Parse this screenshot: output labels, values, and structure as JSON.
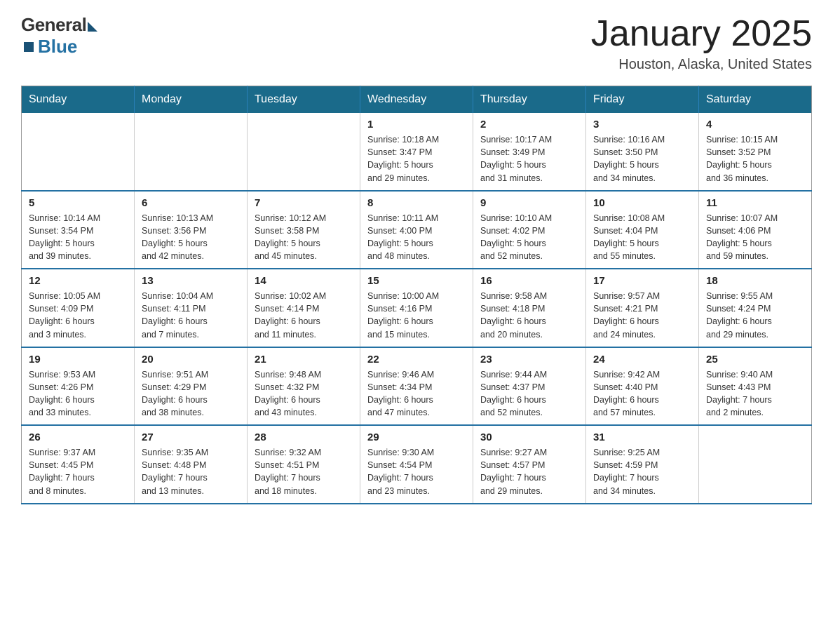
{
  "logo": {
    "general": "General",
    "blue": "Blue"
  },
  "header": {
    "month": "January 2025",
    "location": "Houston, Alaska, United States"
  },
  "weekdays": [
    "Sunday",
    "Monday",
    "Tuesday",
    "Wednesday",
    "Thursday",
    "Friday",
    "Saturday"
  ],
  "weeks": [
    [
      {
        "day": "",
        "info": ""
      },
      {
        "day": "",
        "info": ""
      },
      {
        "day": "",
        "info": ""
      },
      {
        "day": "1",
        "info": "Sunrise: 10:18 AM\nSunset: 3:47 PM\nDaylight: 5 hours\nand 29 minutes."
      },
      {
        "day": "2",
        "info": "Sunrise: 10:17 AM\nSunset: 3:49 PM\nDaylight: 5 hours\nand 31 minutes."
      },
      {
        "day": "3",
        "info": "Sunrise: 10:16 AM\nSunset: 3:50 PM\nDaylight: 5 hours\nand 34 minutes."
      },
      {
        "day": "4",
        "info": "Sunrise: 10:15 AM\nSunset: 3:52 PM\nDaylight: 5 hours\nand 36 minutes."
      }
    ],
    [
      {
        "day": "5",
        "info": "Sunrise: 10:14 AM\nSunset: 3:54 PM\nDaylight: 5 hours\nand 39 minutes."
      },
      {
        "day": "6",
        "info": "Sunrise: 10:13 AM\nSunset: 3:56 PM\nDaylight: 5 hours\nand 42 minutes."
      },
      {
        "day": "7",
        "info": "Sunrise: 10:12 AM\nSunset: 3:58 PM\nDaylight: 5 hours\nand 45 minutes."
      },
      {
        "day": "8",
        "info": "Sunrise: 10:11 AM\nSunset: 4:00 PM\nDaylight: 5 hours\nand 48 minutes."
      },
      {
        "day": "9",
        "info": "Sunrise: 10:10 AM\nSunset: 4:02 PM\nDaylight: 5 hours\nand 52 minutes."
      },
      {
        "day": "10",
        "info": "Sunrise: 10:08 AM\nSunset: 4:04 PM\nDaylight: 5 hours\nand 55 minutes."
      },
      {
        "day": "11",
        "info": "Sunrise: 10:07 AM\nSunset: 4:06 PM\nDaylight: 5 hours\nand 59 minutes."
      }
    ],
    [
      {
        "day": "12",
        "info": "Sunrise: 10:05 AM\nSunset: 4:09 PM\nDaylight: 6 hours\nand 3 minutes."
      },
      {
        "day": "13",
        "info": "Sunrise: 10:04 AM\nSunset: 4:11 PM\nDaylight: 6 hours\nand 7 minutes."
      },
      {
        "day": "14",
        "info": "Sunrise: 10:02 AM\nSunset: 4:14 PM\nDaylight: 6 hours\nand 11 minutes."
      },
      {
        "day": "15",
        "info": "Sunrise: 10:00 AM\nSunset: 4:16 PM\nDaylight: 6 hours\nand 15 minutes."
      },
      {
        "day": "16",
        "info": "Sunrise: 9:58 AM\nSunset: 4:18 PM\nDaylight: 6 hours\nand 20 minutes."
      },
      {
        "day": "17",
        "info": "Sunrise: 9:57 AM\nSunset: 4:21 PM\nDaylight: 6 hours\nand 24 minutes."
      },
      {
        "day": "18",
        "info": "Sunrise: 9:55 AM\nSunset: 4:24 PM\nDaylight: 6 hours\nand 29 minutes."
      }
    ],
    [
      {
        "day": "19",
        "info": "Sunrise: 9:53 AM\nSunset: 4:26 PM\nDaylight: 6 hours\nand 33 minutes."
      },
      {
        "day": "20",
        "info": "Sunrise: 9:51 AM\nSunset: 4:29 PM\nDaylight: 6 hours\nand 38 minutes."
      },
      {
        "day": "21",
        "info": "Sunrise: 9:48 AM\nSunset: 4:32 PM\nDaylight: 6 hours\nand 43 minutes."
      },
      {
        "day": "22",
        "info": "Sunrise: 9:46 AM\nSunset: 4:34 PM\nDaylight: 6 hours\nand 47 minutes."
      },
      {
        "day": "23",
        "info": "Sunrise: 9:44 AM\nSunset: 4:37 PM\nDaylight: 6 hours\nand 52 minutes."
      },
      {
        "day": "24",
        "info": "Sunrise: 9:42 AM\nSunset: 4:40 PM\nDaylight: 6 hours\nand 57 minutes."
      },
      {
        "day": "25",
        "info": "Sunrise: 9:40 AM\nSunset: 4:43 PM\nDaylight: 7 hours\nand 2 minutes."
      }
    ],
    [
      {
        "day": "26",
        "info": "Sunrise: 9:37 AM\nSunset: 4:45 PM\nDaylight: 7 hours\nand 8 minutes."
      },
      {
        "day": "27",
        "info": "Sunrise: 9:35 AM\nSunset: 4:48 PM\nDaylight: 7 hours\nand 13 minutes."
      },
      {
        "day": "28",
        "info": "Sunrise: 9:32 AM\nSunset: 4:51 PM\nDaylight: 7 hours\nand 18 minutes."
      },
      {
        "day": "29",
        "info": "Sunrise: 9:30 AM\nSunset: 4:54 PM\nDaylight: 7 hours\nand 23 minutes."
      },
      {
        "day": "30",
        "info": "Sunrise: 9:27 AM\nSunset: 4:57 PM\nDaylight: 7 hours\nand 29 minutes."
      },
      {
        "day": "31",
        "info": "Sunrise: 9:25 AM\nSunset: 4:59 PM\nDaylight: 7 hours\nand 34 minutes."
      },
      {
        "day": "",
        "info": ""
      }
    ]
  ]
}
